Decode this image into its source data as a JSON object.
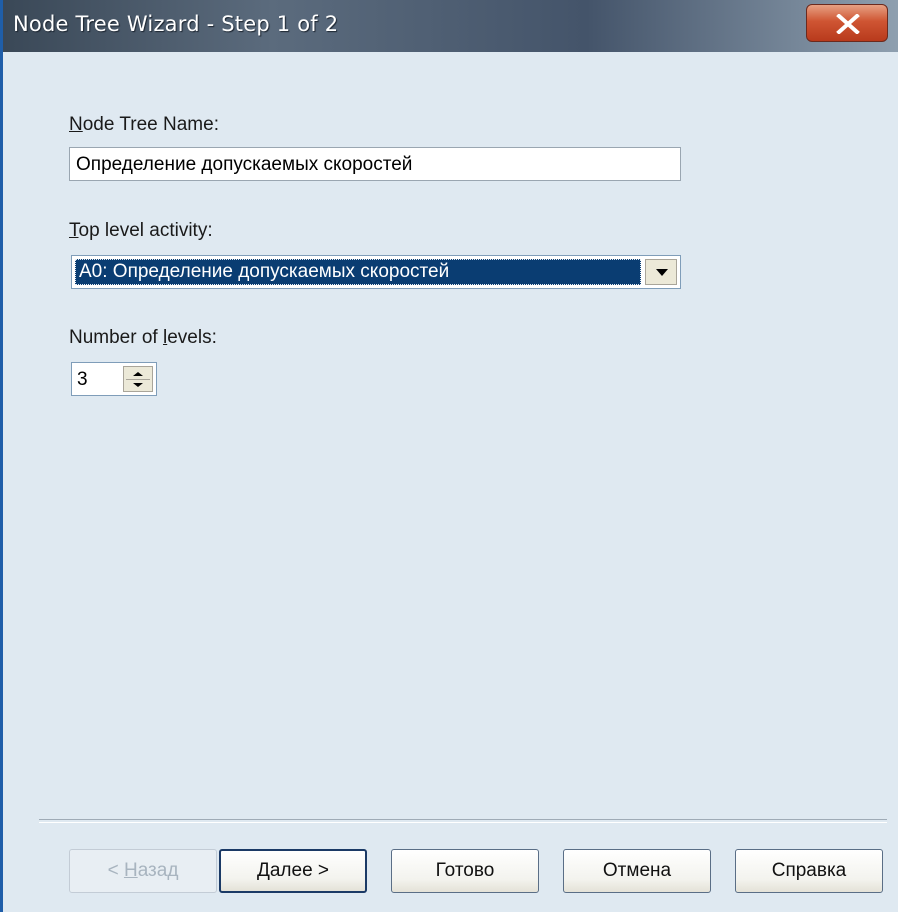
{
  "window": {
    "title": "Node Tree Wizard - Step 1 of 2"
  },
  "form": {
    "name_label_mnemonic": "N",
    "name_label_rest": "ode Tree Name:",
    "name_value": "Определение допускаемых скоростей",
    "activity_label_mnemonic": "T",
    "activity_label_rest": "op level activity:",
    "activity_value": "A0:  Определение допускаемых скоростей",
    "levels_label_pre": "Number of ",
    "levels_label_mnemonic": "l",
    "levels_label_post": "evels:",
    "levels_value": "3"
  },
  "buttons": {
    "back_prefix": "< ",
    "back_mnemonic": "Н",
    "back_rest": "азад",
    "next_mnemonic": "Д",
    "next_rest": "алее >",
    "finish_label": "Готово",
    "cancel_label": "Отмена",
    "help_label": "Справка"
  },
  "colors": {
    "titlebar": "#3a4857",
    "client_bg": "#dfe9f1",
    "selection": "#0a3d72",
    "close_button": "#cf5533"
  },
  "icons": {
    "close": "close-icon",
    "combo_arrow": "chevron-down-icon",
    "spin_up": "spin-up-icon",
    "spin_down": "spin-down-icon"
  }
}
